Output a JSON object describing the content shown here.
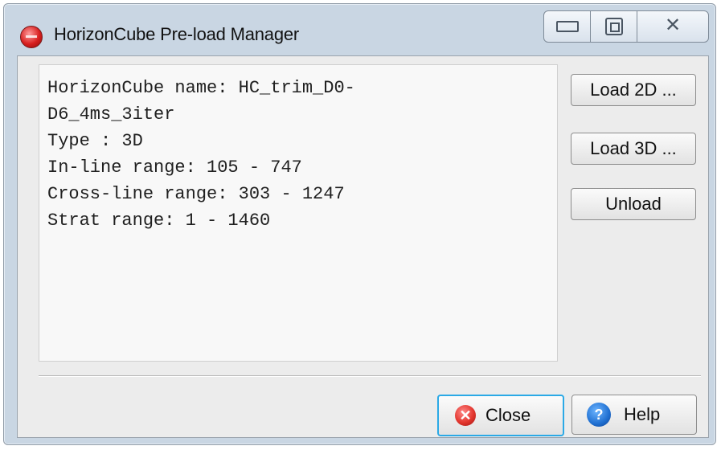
{
  "window": {
    "title": "HorizonCube Pre-load Manager",
    "controls": {
      "minimize": "minimize",
      "maximize": "maximize",
      "close": "✕"
    }
  },
  "info": {
    "lines": [
      "HorizonCube name: HC_trim_D0-",
      "D6_4ms_3iter",
      "Type : 3D",
      "In-line range: 105 - 747",
      "Cross-line range: 303 - 1247",
      "Strat range: 1 - 1460"
    ]
  },
  "buttons": {
    "load2d": "Load 2D ...",
    "load3d": "Load 3D ...",
    "unload": "Unload",
    "close": "Close",
    "help": "Help"
  },
  "icons": {
    "close_icon": "✕",
    "help_icon": "?"
  }
}
